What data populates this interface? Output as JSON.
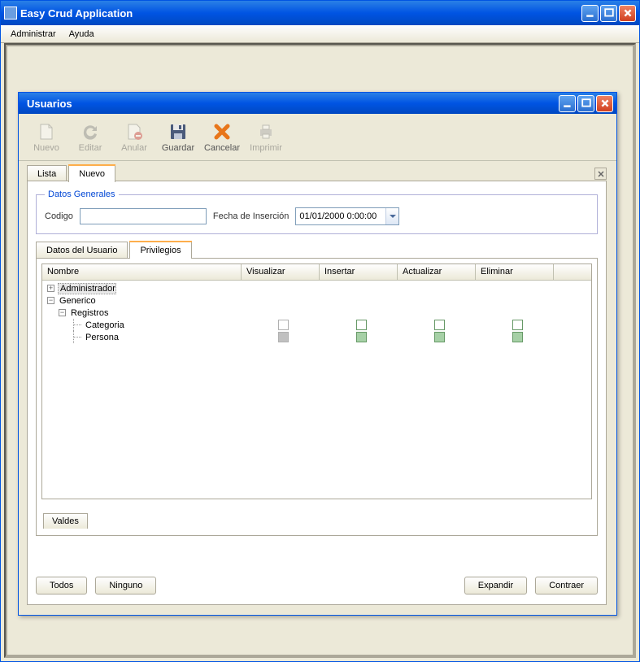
{
  "main_window": {
    "title": "Easy Crud Application",
    "menu": {
      "administrar": "Administrar",
      "ayuda": "Ayuda"
    }
  },
  "dialog": {
    "title": "Usuarios",
    "toolbar": {
      "nuevo": "Nuevo",
      "editar": "Editar",
      "anular": "Anular",
      "guardar": "Guardar",
      "cancelar": "Cancelar",
      "imprimir": "Imprimir"
    },
    "tabs": {
      "lista": "Lista",
      "nuevo": "Nuevo"
    },
    "datos_generales": {
      "legend": "Datos Generales",
      "codigo_label": "Codigo",
      "codigo_value": "",
      "fecha_label": "Fecha de Inserción",
      "fecha_value": "01/01/2000 0:00:00"
    },
    "subtabs": {
      "datos_usuario": "Datos del Usuario",
      "privilegios": "Privilegios"
    },
    "priv_columns": {
      "nombre": "Nombre",
      "visualizar": "Visualizar",
      "insertar": "Insertar",
      "actualizar": "Actualizar",
      "eliminar": "Eliminar"
    },
    "tree": {
      "administrador": "Administrador",
      "generico": "Generico",
      "registros": "Registros",
      "categoria": "Categoria",
      "persona": "Persona"
    },
    "valdes": "Valdes",
    "buttons": {
      "todos": "Todos",
      "ninguno": "Ninguno",
      "expandir": "Expandir",
      "contraer": "Contraer"
    }
  }
}
